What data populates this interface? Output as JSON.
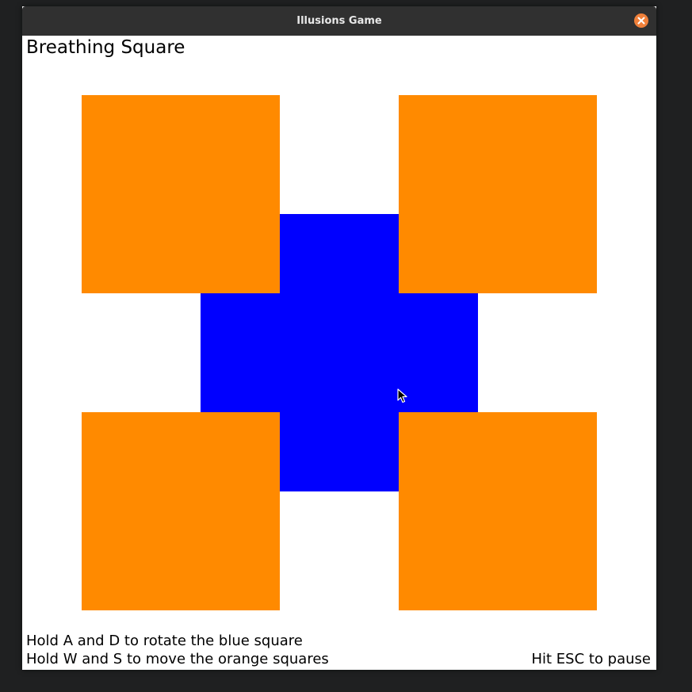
{
  "window": {
    "title": "Illusions Game",
    "close_icon": "close-icon"
  },
  "game": {
    "title": "Breathing Square",
    "instructions": {
      "rotate": "Hold A and D to rotate the blue square",
      "move": "Hold W and S to move the orange squares",
      "pause": "Hit ESC to pause"
    }
  },
  "colors": {
    "orange": "#ff8a00",
    "blue": "#0000ff",
    "background": "#ffffff",
    "titlebar": "#303030",
    "close_button": "#f0803a"
  }
}
